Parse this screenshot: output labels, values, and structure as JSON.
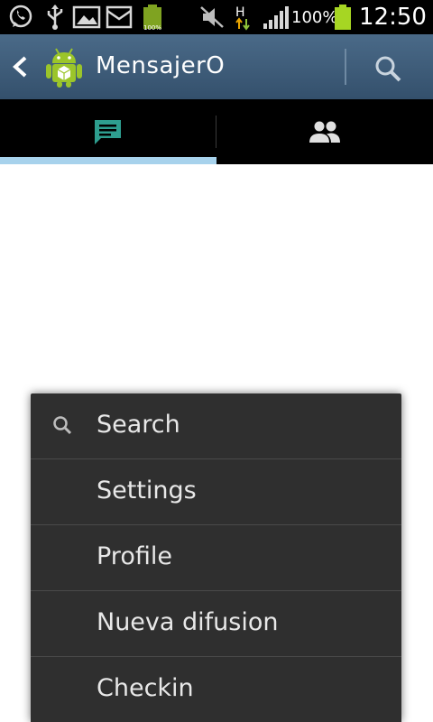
{
  "status_bar": {
    "battery_percent": "100%",
    "time": "12:50",
    "network_type": "H",
    "icons": [
      "whatsapp-icon",
      "usb-icon",
      "gallery-icon",
      "mail-icon",
      "battery-small-icon",
      "mute-icon",
      "network-h-icon",
      "signal-icon",
      "battery-icon"
    ]
  },
  "action_bar": {
    "title": "MensajerO",
    "background_color": "#3e5c7a"
  },
  "tabs": [
    {
      "icon": "chat-icon",
      "selected": true
    },
    {
      "icon": "people-icon",
      "selected": false
    }
  ],
  "menu": {
    "items": [
      {
        "label": "Search",
        "icon": "search-icon"
      },
      {
        "label": "Settings"
      },
      {
        "label": "Profile"
      },
      {
        "label": "Nueva difusion"
      },
      {
        "label": "Checkin"
      }
    ]
  },
  "colors": {
    "accent": "#a7d2ec",
    "chat_icon": "#2e9e8f",
    "menu_bg": "#2f2f2f",
    "android_green": "#9bc52a"
  }
}
